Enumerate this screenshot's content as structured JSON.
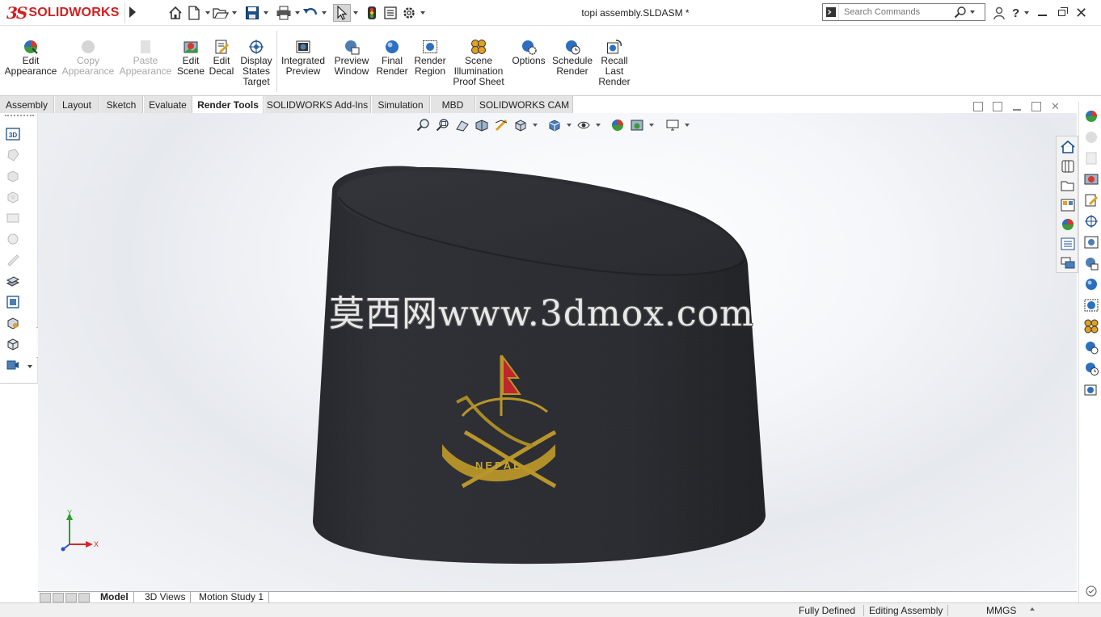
{
  "app": {
    "brand": "SOLIDWORKS",
    "brand_mark": "3S",
    "document_title": "topi assembly.SLDASM *"
  },
  "search": {
    "placeholder": "Search Commands"
  },
  "toolbar_tools": [
    {
      "label1": "Edit",
      "label2": "Appearance",
      "label3": "",
      "enabled": true,
      "icon": "edit-appearance-icon"
    },
    {
      "label1": "Copy",
      "label2": "Appearance",
      "label3": "",
      "enabled": false,
      "icon": "copy-appearance-icon"
    },
    {
      "label1": "Paste",
      "label2": "Appearance",
      "label3": "",
      "enabled": false,
      "icon": "paste-appearance-icon"
    },
    {
      "label1": "Edit",
      "label2": "Scene",
      "label3": "",
      "enabled": true,
      "icon": "edit-scene-icon"
    },
    {
      "label1": "Edit",
      "label2": "Decal",
      "label3": "",
      "enabled": true,
      "icon": "edit-decal-icon"
    },
    {
      "label1": "Display",
      "label2": "States",
      "label3": "Target",
      "enabled": true,
      "icon": "display-states-target-icon"
    },
    {
      "label1": "Integrated",
      "label2": "Preview",
      "label3": "",
      "enabled": true,
      "icon": "integrated-preview-icon"
    },
    {
      "label1": "Preview",
      "label2": "Window",
      "label3": "",
      "enabled": true,
      "icon": "preview-window-icon"
    },
    {
      "label1": "Final",
      "label2": "Render",
      "label3": "",
      "enabled": true,
      "icon": "final-render-icon"
    },
    {
      "label1": "Render",
      "label2": "Region",
      "label3": "",
      "enabled": true,
      "icon": "render-region-icon"
    },
    {
      "label1": "Scene",
      "label2": "Illumination",
      "label3": "Proof Sheet",
      "enabled": true,
      "icon": "scene-illumination-icon"
    },
    {
      "label1": "Options",
      "label2": "",
      "label3": "",
      "enabled": true,
      "icon": "options-icon"
    },
    {
      "label1": "Schedule",
      "label2": "Render",
      "label3": "",
      "enabled": true,
      "icon": "schedule-render-icon"
    },
    {
      "label1": "Recall",
      "label2": "Last",
      "label3": "Render",
      "enabled": true,
      "icon": "recall-last-render-icon"
    }
  ],
  "tabs": [
    "Assembly",
    "Layout",
    "Sketch",
    "Evaluate",
    "Render Tools",
    "SOLIDWORKS Add-Ins",
    "Simulation",
    "MBD",
    "SOLIDWORKS CAM"
  ],
  "active_tab": "Render Tools",
  "viewport": {
    "watermark": "莫西网www.3dmox.com",
    "emblem_text": "NEPAL",
    "triad_x": "X",
    "triad_y": "Y",
    "model_color": "#2a2b30",
    "emblem_color": "#b8962a",
    "flag_color": "#c0262c"
  },
  "bottom_tabs": [
    "Model",
    "3D Views",
    "Motion Study 1"
  ],
  "active_bottom_tab": "Model",
  "status": {
    "state": "Fully Defined",
    "mode": "Editing Assembly",
    "units": "MMGS"
  }
}
